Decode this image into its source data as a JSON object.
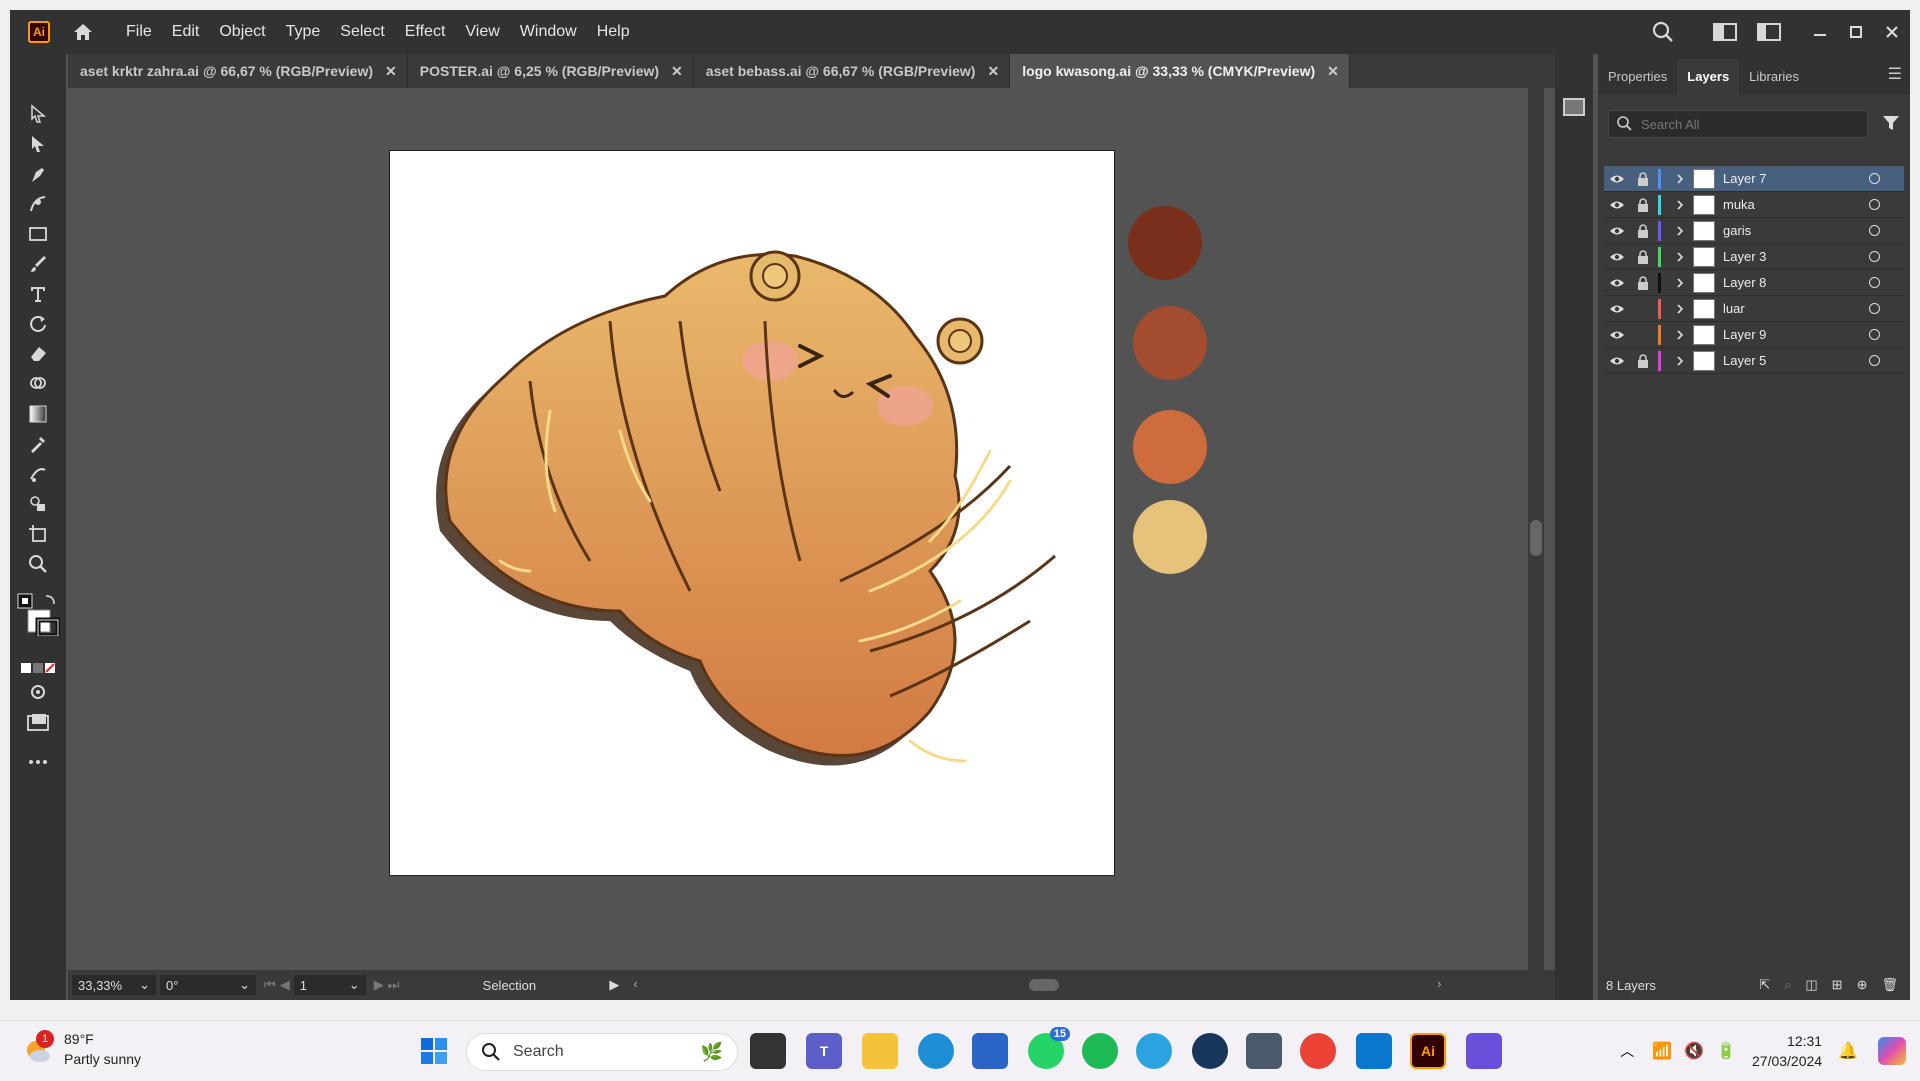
{
  "app": {
    "logo": "Ai",
    "menu": [
      "File",
      "Edit",
      "Object",
      "Type",
      "Select",
      "Effect",
      "View",
      "Window",
      "Help"
    ]
  },
  "tabs": [
    {
      "label": "aset krktr zahra.ai @ 66,67 % (RGB/Preview)",
      "active": false
    },
    {
      "label": "POSTER.ai @ 6,25 % (RGB/Preview)",
      "active": false
    },
    {
      "label": "aset bebass.ai @ 66,67 % (RGB/Preview)",
      "active": false
    },
    {
      "label": "logo kwasong.ai @ 33,33 % (CMYK/Preview)",
      "active": true
    }
  ],
  "swatches": [
    "#7a2f1a",
    "#a44c30",
    "#cf6c3c",
    "#e6c27a"
  ],
  "status": {
    "zoom": "33,33%",
    "rotation": "0°",
    "artboard": "1",
    "tool": "Selection"
  },
  "panel": {
    "tabs": [
      "Properties",
      "Layers",
      "Libraries"
    ],
    "active_tab": "Layers",
    "search_placeholder": "Search All",
    "layers": [
      {
        "name": "Layer 7",
        "color": "#4f8ff7",
        "locked": true,
        "selected": true
      },
      {
        "name": "muka",
        "color": "#35d6e8",
        "locked": true,
        "selected": false
      },
      {
        "name": "garis",
        "color": "#6a5af9",
        "locked": true,
        "selected": false
      },
      {
        "name": "Layer 3",
        "color": "#46d85a",
        "locked": true,
        "selected": false
      },
      {
        "name": "Layer 8",
        "color": "#111111",
        "locked": true,
        "selected": false
      },
      {
        "name": "luar",
        "color": "#f25a5a",
        "locked": false,
        "selected": false
      },
      {
        "name": "Layer 9",
        "color": "#f07a2a",
        "locked": false,
        "selected": false
      },
      {
        "name": "Layer 5",
        "color": "#e040e0",
        "locked": true,
        "selected": false
      }
    ],
    "footer": "8 Layers"
  },
  "taskbar": {
    "weather_temp": "89°F",
    "weather_desc": "Partly sunny",
    "weather_badge": "1",
    "search": "Search",
    "whatsapp_badge": "15",
    "time": "12:31",
    "date": "27/03/2024"
  }
}
